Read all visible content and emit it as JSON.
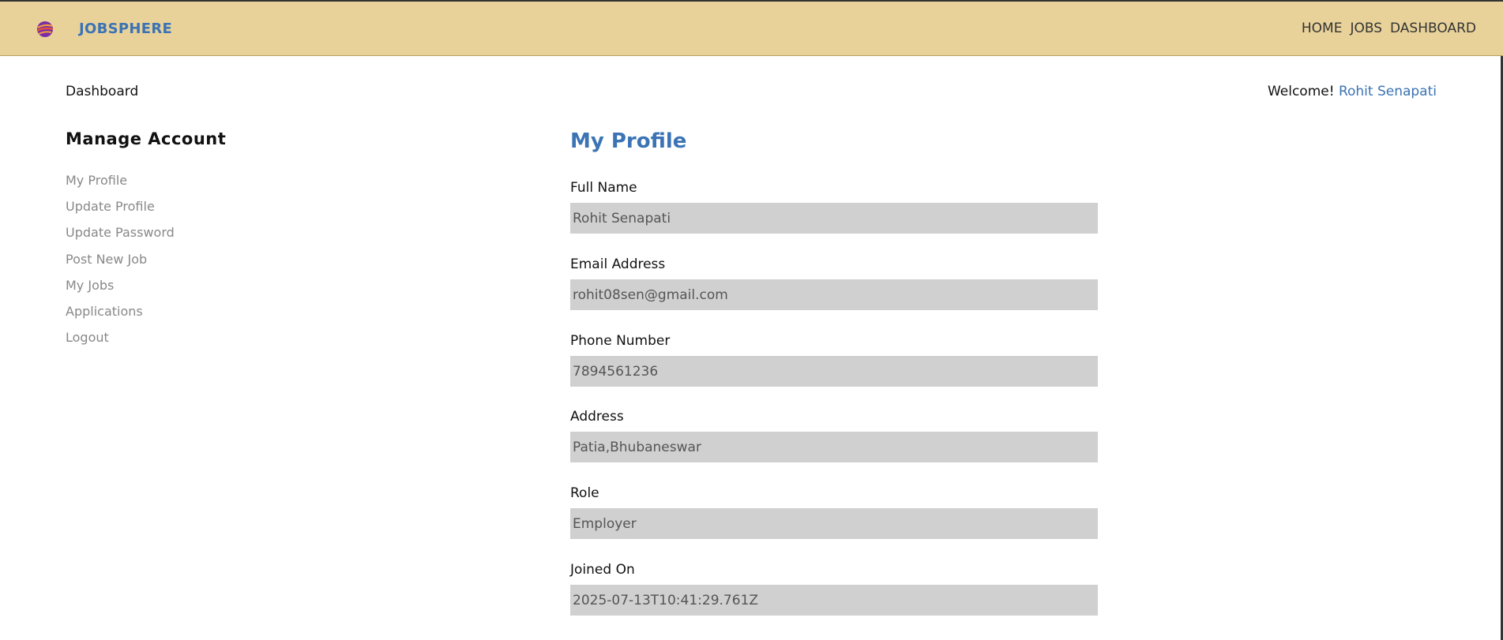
{
  "header": {
    "brand": "JOBSPHERE",
    "logo_icon": "globe-logo-icon",
    "nav": [
      "HOME",
      "JOBS",
      "DASHBOARD"
    ]
  },
  "breadcrumb": "Dashboard",
  "welcome": {
    "prefix": "Welcome!",
    "user": "Rohit Senapati"
  },
  "sidebar": {
    "title": "Manage Account",
    "items": [
      "My Profile",
      "Update Profile",
      "Update Password",
      "Post New Job",
      "My Jobs",
      "Applications",
      "Logout"
    ]
  },
  "profile": {
    "title": "My Profile",
    "fields": [
      {
        "label": "Full Name",
        "value": "Rohit Senapati"
      },
      {
        "label": "Email Address",
        "value": "rohit08sen@gmail.com"
      },
      {
        "label": "Phone Number",
        "value": "7894561236"
      },
      {
        "label": "Address",
        "value": "Patia,Bhubaneswar"
      },
      {
        "label": "Role",
        "value": "Employer"
      },
      {
        "label": "Joined On",
        "value": "2025-07-13T10:41:29.761Z"
      }
    ]
  },
  "colors": {
    "header_bg": "#e8d29a",
    "accent": "#3b73b4",
    "field_bg": "#d0d0d0"
  }
}
